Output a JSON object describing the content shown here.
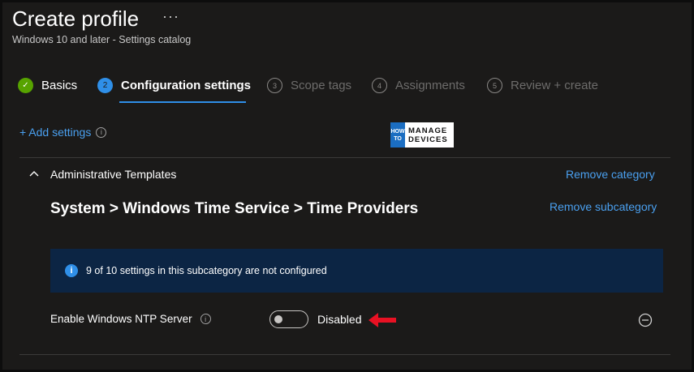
{
  "header": {
    "title": "Create profile",
    "more_label": "···",
    "subtitle": "Windows 10 and later - Settings catalog"
  },
  "steps": [
    {
      "number": "✓",
      "label": "Basics",
      "state": "done"
    },
    {
      "number": "2",
      "label": "Configuration settings",
      "state": "active"
    },
    {
      "number": "3",
      "label": "Scope tags",
      "state": "pending"
    },
    {
      "number": "4",
      "label": "Assignments",
      "state": "pending"
    },
    {
      "number": "5",
      "label": "Review + create",
      "state": "pending"
    }
  ],
  "toolbar": {
    "add_settings_label": "+ Add settings",
    "info_icon": "i"
  },
  "logo": {
    "how": "HOW",
    "to": "TO",
    "line1": "MANAGE",
    "line2": "DEVICES"
  },
  "category": {
    "label": "Administrative Templates",
    "remove_label": "Remove category"
  },
  "subcategory": {
    "title": "System > Windows Time Service > Time Providers",
    "remove_label": "Remove subcategory"
  },
  "info_bar": {
    "icon": "i",
    "text": "9 of 10 settings in this subcategory are not configured"
  },
  "setting": {
    "label": "Enable Windows NTP Server",
    "info_icon": "i",
    "toggle_state": "Disabled"
  },
  "colors": {
    "background": "#1b1a19",
    "accent": "#2f8fe8",
    "link": "#4aa0f0",
    "success": "#57a300",
    "info_bar": "#0c2544",
    "annotation_arrow": "#e81123"
  }
}
